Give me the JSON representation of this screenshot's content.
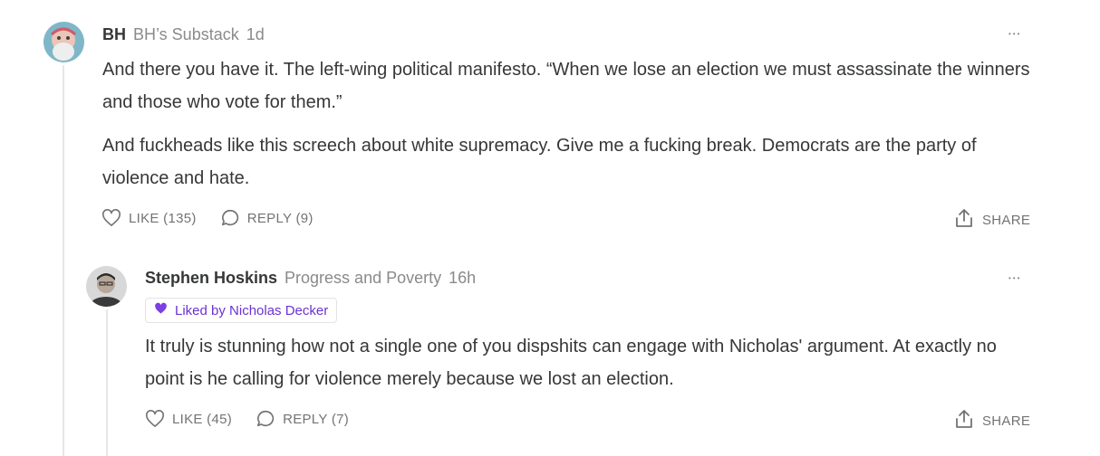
{
  "comments": [
    {
      "author": "BH",
      "publication": "BH’s Substack",
      "age": "1d",
      "more": "•••",
      "paragraphs": [
        "And there you have it. The left-wing political manifesto. “When we lose an election we must assassinate the winners and those who vote for them.”",
        "And fuckheads like this screech about white supremacy. Give me a fucking break. Democrats are the party of violence and hate."
      ],
      "like_label": "LIKE (135)",
      "reply_label": "REPLY (9)",
      "share_label": "SHARE"
    },
    {
      "author": "Stephen Hoskins",
      "publication": "Progress and Poverty",
      "age": "16h",
      "more": "•••",
      "liked_by": "Liked by Nicholas Decker",
      "paragraphs": [
        "It truly is stunning how not a single one of you dispshits can engage with Nicholas' argument. At exactly no point is he calling for violence merely because we lost an election."
      ],
      "like_label": "LIKE (45)",
      "reply_label": "REPLY (7)",
      "share_label": "SHARE"
    }
  ],
  "colors": {
    "text": "#363737",
    "muted": "#8a8a8a",
    "action": "#737373",
    "liked_accent": "#6b33d3",
    "thread_line": "#e6e6e6"
  }
}
